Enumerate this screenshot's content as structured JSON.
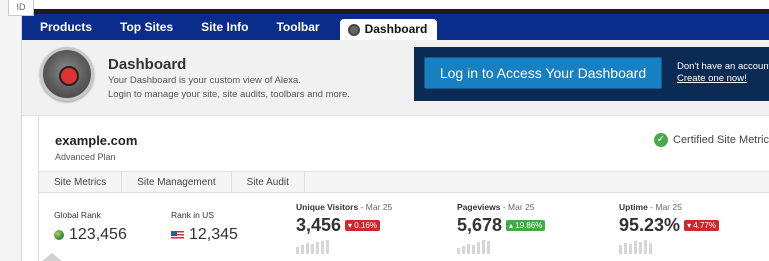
{
  "corner_badge": "ID",
  "nav": {
    "items": [
      "Products",
      "Top Sites",
      "Site Info",
      "Toolbar"
    ],
    "active": "Dashboard"
  },
  "header": {
    "title": "Dashboard",
    "line1": "Your Dashboard is your custom view of Alexa.",
    "line2": "Login to manage your site, site audits, toolbars and more.",
    "login_button": "Log in to Access Your Dashboard",
    "no_account": "Don't have an account?",
    "create_link": "Create one now!"
  },
  "site": {
    "name": "example.com",
    "plan": "Advanced Plan",
    "certified": "Certified Site Metrics"
  },
  "subtabs": [
    "Site Metrics",
    "Site Management",
    "Site Audit"
  ],
  "metrics": {
    "global_rank": {
      "label": "Global Rank",
      "value": "123,456"
    },
    "us_rank": {
      "label": "Rank in US",
      "value": "12,345"
    },
    "unique_visitors": {
      "label": "Unique Visitors",
      "date": " - Mar 25",
      "value": "3,456",
      "change": "▾ 0.16%",
      "direction": "down"
    },
    "pageviews": {
      "label": "Pageviews",
      "date": " - Mar 25",
      "value": "5,678",
      "change": "▴ 19.86%",
      "direction": "up"
    },
    "uptime": {
      "label": "Uptime",
      "date": " - Mar 25",
      "value": "95.23%",
      "change": "▾ 4.77%",
      "direction": "down"
    }
  },
  "colors": {
    "nav_bg": "#0a2d8c",
    "login_panel": "#0b2a54",
    "login_button": "#1780c2",
    "down": "#c92a2a",
    "up": "#44a947"
  }
}
